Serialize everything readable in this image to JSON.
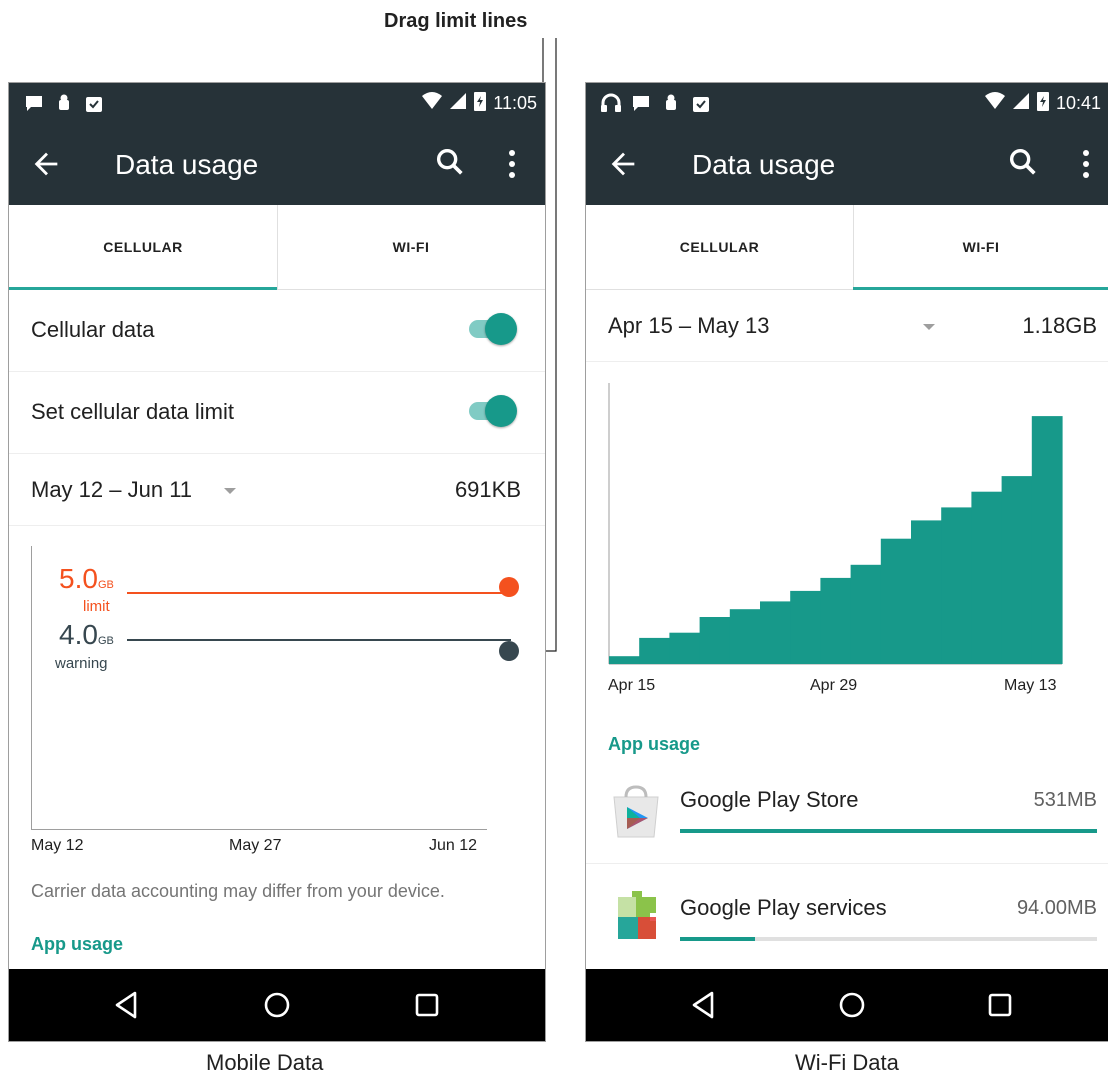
{
  "callout": {
    "drag_limit_lines": "Drag limit lines"
  },
  "captions": {
    "left": "Mobile Data",
    "right": "Wi-Fi Data"
  },
  "left": {
    "clock": "11:05",
    "title": "Data usage",
    "tabs": [
      {
        "label": "CELLULAR",
        "selected": true
      },
      {
        "label": "WI-FI",
        "selected": false
      }
    ],
    "cellular_data": {
      "label": "Cellular data",
      "on": true
    },
    "set_limit": {
      "label": "Set cellular data limit",
      "on": true
    },
    "cycle": {
      "range": "May 12 – Jun 11",
      "total": "691KB"
    },
    "limit": {
      "value": "5.0",
      "unit": "GB",
      "label": "limit",
      "color": "#f4511e"
    },
    "warning": {
      "value": "4.0",
      "unit": "GB",
      "label": "warning",
      "color": "#37474f"
    },
    "x_axis": [
      "May 12",
      "May 27",
      "Jun 12"
    ],
    "disclaimer": "Carrier data accounting may differ from your device.",
    "app_usage_title": "App usage"
  },
  "right": {
    "clock": "10:41",
    "title": "Data usage",
    "tabs": [
      {
        "label": "CELLULAR",
        "selected": false
      },
      {
        "label": "WI-FI",
        "selected": true
      }
    ],
    "cycle": {
      "range": "Apr 15 – May 13",
      "total": "1.18GB"
    },
    "x_axis": [
      "Apr 15",
      "Apr 29",
      "May 13"
    ],
    "app_usage_title": "App usage",
    "apps": [
      {
        "name": "Google Play Store",
        "size": "531MB",
        "fraction": 1.0,
        "icon": "google-play-store-icon"
      },
      {
        "name": "Google Play services",
        "size": "94.00MB",
        "fraction": 0.18,
        "icon": "google-play-services-icon"
      }
    ]
  },
  "colors": {
    "toolbar": "#263238",
    "accent": "#17998a",
    "limit": "#f4511e",
    "warning": "#37474f"
  },
  "chart_data": {
    "type": "area",
    "xlabel": "",
    "ylabel": "",
    "x": [
      "Apr 15",
      "Apr 17",
      "Apr 19",
      "Apr 21",
      "Apr 23",
      "Apr 25",
      "Apr 27",
      "Apr 29",
      "May 1",
      "May 3",
      "May 5",
      "May 7",
      "May 9",
      "May 11",
      "May 13"
    ],
    "y": [
      0.03,
      0.1,
      0.12,
      0.18,
      0.21,
      0.24,
      0.28,
      0.33,
      0.38,
      0.48,
      0.55,
      0.6,
      0.66,
      0.72,
      0.95
    ],
    "x_tick_labels": [
      "Apr 15",
      "Apr 29",
      "May 13"
    ],
    "grid": false,
    "color": "#17998a"
  }
}
